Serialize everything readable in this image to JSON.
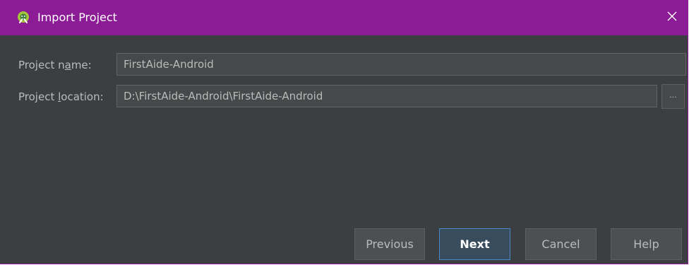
{
  "window": {
    "title": "Import Project",
    "title_icon": "android-studio-icon",
    "close_icon": "close-icon"
  },
  "form": {
    "project_name_label_pre": "Project n",
    "project_name_label_mnemonic": "a",
    "project_name_label_post": "me:",
    "project_name_value": "FirstAide-Android",
    "project_location_label_pre": "Project ",
    "project_location_label_mnemonic": "l",
    "project_location_label_post": "ocation:",
    "project_location_value": "D:\\FirstAide-Android\\FirstAide-Android",
    "browse_label": "..."
  },
  "buttons": {
    "previous": "Previous",
    "next": "Next",
    "cancel": "Cancel",
    "help": "Help"
  },
  "colors": {
    "titlebar": "#8c1b96",
    "background": "#3c3f41",
    "default_button_border": "#4a88c7"
  }
}
